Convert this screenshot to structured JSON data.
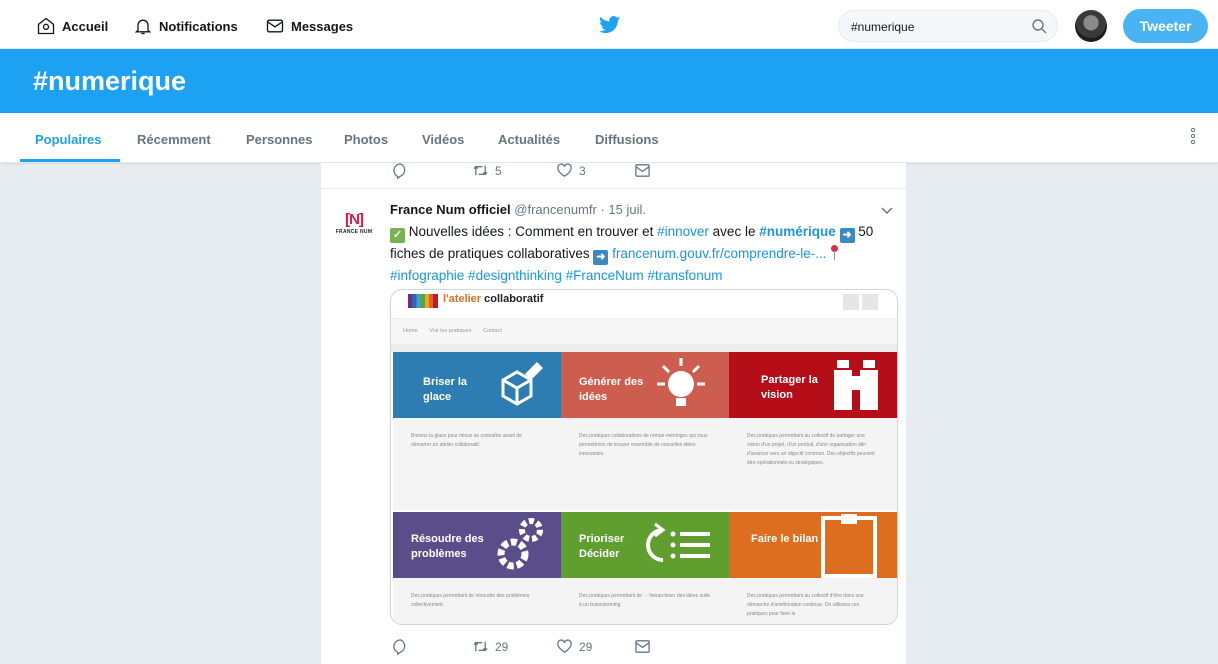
{
  "colors": {
    "accent": "#1da1f2",
    "tile_blue": "#2d7db3",
    "tile_salmon": "#cc5d4f",
    "tile_red": "#b50e18",
    "tile_purple": "#5a4e8a",
    "tile_green": "#5f9e2f",
    "tile_orange": "#dd6e1f"
  },
  "topnav": {
    "home": "Accueil",
    "notifications": "Notifications",
    "messages": "Messages",
    "search_value": "#numerique",
    "tweet_button": "Tweeter"
  },
  "banner": {
    "title": "#numerique"
  },
  "tabs": [
    "Populaires",
    "Récemment",
    "Personnes",
    "Photos",
    "Vidéos",
    "Actualités",
    "Diffusions"
  ],
  "prev_tweet": {
    "retweets": "5",
    "likes": "3"
  },
  "tweet": {
    "logo_text": "FRANCE NUM",
    "name": "France Num officiel",
    "handle": "@francenumfr",
    "sep": " · ",
    "date": "15 juil.",
    "text_1": " Nouvelles idées : Comment en trouver et ",
    "tag_innover": "#innover",
    "text_2": " avec le ",
    "tag_numerique": "#numérique",
    "text_3": " 50 fiches de pratiques collaboratives ",
    "link": "francenum.gouv.fr/comprendre-le-...",
    "tags_line": "#infographie #designthinking #FranceNum #transfonum",
    "retweets": "29",
    "likes": "29"
  },
  "card": {
    "title_orange": "l'atelier",
    "title_black": " collaboratif",
    "nav": [
      "Home",
      "Voir les pratiques",
      "Contact"
    ],
    "tiles": [
      {
        "label": "Briser la glace",
        "desc": "Brisons la glace pour mieux se connaître avant de démarrer un atelier collaboratif."
      },
      {
        "label": "Générer des idées",
        "desc": "Des pratiques collaboratives de remue-méninges qui vous permettrons de trouver ensemble de nouvelles idées innovantes."
      },
      {
        "label": "Partager la vision",
        "desc": "Des pratiques permettant au collectif de partager une vision d'un projet, d'un produit, d'une organisation afin d'avancer vers un objectif commun. Des objectifs peuvent être opérationnels ou stratégiques."
      },
      {
        "label": "Résoudre des problèmes",
        "desc": "Des pratiques permettant de résoudre des problèmes collectivement."
      },
      {
        "label": "Prioriser Décider",
        "desc": "Des pratiques permettant de : - hiérarchiser des idées suite à un brainstorming"
      },
      {
        "label": "Faire le bilan",
        "desc": "Des pratiques permettant au collectif d'être dans une démarche d'amélioration continue. On utilisera ces pratiques pour faire le"
      }
    ]
  }
}
